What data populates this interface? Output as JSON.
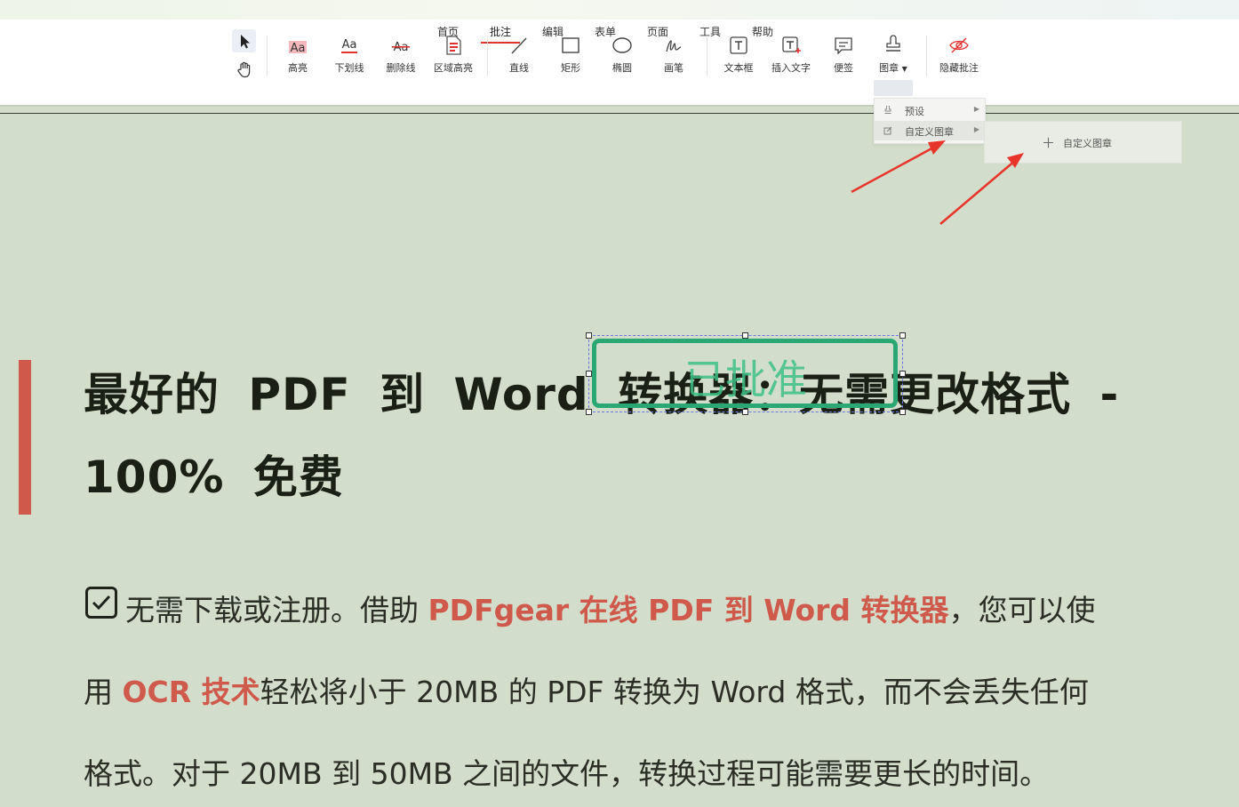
{
  "tabs": [
    {
      "label": "首页"
    },
    {
      "label": "批注"
    },
    {
      "label": "编辑"
    },
    {
      "label": "表单"
    },
    {
      "label": "页面"
    },
    {
      "label": "工具"
    },
    {
      "label": "帮助"
    }
  ],
  "active_tab": "批注",
  "tools": {
    "highlight": "高亮",
    "underline": "下划线",
    "strikethrough": "删除线",
    "area_highlight": "区域高亮",
    "line": "直线",
    "rectangle": "矩形",
    "ellipse": "椭圆",
    "pen": "画笔",
    "textbox": "文本框",
    "insert_text": "插入文字",
    "sticky_note": "便签",
    "stamp": "图章",
    "hide_annotations": "隐藏批注"
  },
  "tool_glyphs": {
    "highlight": "Aa",
    "underline": "Aa",
    "strikethrough": "Aa"
  },
  "stamp_menu": {
    "preset": "预设",
    "custom": "自定义图章"
  },
  "submenu": {
    "add_custom": "自定义图章"
  },
  "stamp_annotation": {
    "text": "已批准",
    "color": "#2aa873"
  },
  "content": {
    "title_line1": "最好的 PDF 到 Word 转换器：无需更改格式 -",
    "title_line2": "100% 免费",
    "p1_a": "无需下载或注册。借助 ",
    "p1_red": "PDFgear 在线 PDF 到 Word 转换器",
    "p1_b": "，您可以使",
    "p2_a": "用 ",
    "p2_red": "OCR 技术",
    "p2_b": "轻松将小于 20MB 的 PDF 转换为 Word 格式，而不会丢失任何",
    "p3": "格式。对于 20MB 到 50MB 之间的文件，转换过程可能需要更长的时间。"
  },
  "colors": {
    "accent": "#e0312f",
    "link_red": "#cf5a4c",
    "background": "#d3ddcb"
  }
}
